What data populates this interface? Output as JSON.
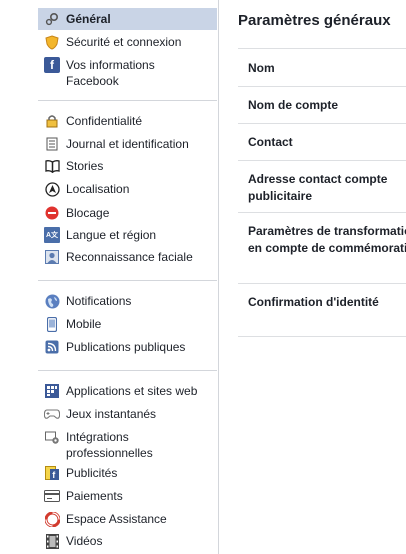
{
  "sidebar": {
    "items": [
      {
        "label": "Général",
        "icon": "gears-icon"
      },
      {
        "label": "Sécurité et connexion",
        "icon": "shield-icon"
      },
      {
        "label": "Vos informations Facebook",
        "icon": "facebook-icon"
      },
      {
        "label": "Confidentialité",
        "icon": "lock-icon"
      },
      {
        "label": "Journal et identification",
        "icon": "journal-icon"
      },
      {
        "label": "Stories",
        "icon": "book-icon"
      },
      {
        "label": "Localisation",
        "icon": "location-icon"
      },
      {
        "label": "Blocage",
        "icon": "block-icon"
      },
      {
        "label": "Langue et région",
        "icon": "language-icon"
      },
      {
        "label": "Reconnaissance faciale",
        "icon": "face-icon"
      },
      {
        "label": "Notifications",
        "icon": "globe-icon"
      },
      {
        "label": "Mobile",
        "icon": "mobile-icon"
      },
      {
        "label": "Publications publiques",
        "icon": "rss-icon"
      },
      {
        "label": "Applications et sites web",
        "icon": "apps-icon"
      },
      {
        "label": "Jeux instantanés",
        "icon": "gamepad-icon"
      },
      {
        "label": "Intégrations professionnelles",
        "icon": "business-gear-icon"
      },
      {
        "label": "Publicités",
        "icon": "ads-icon"
      },
      {
        "label": "Paiements",
        "icon": "card-icon"
      },
      {
        "label": "Espace Assistance",
        "icon": "lifebuoy-icon"
      },
      {
        "label": "Vidéos",
        "icon": "film-icon"
      }
    ]
  },
  "main": {
    "title": "Paramètres généraux",
    "rows": [
      "Nom",
      "Nom de compte",
      "Contact",
      "Adresse contact compte publicitaire",
      "Paramètres de transformation en compte de commémoration",
      "Confirmation d'identité"
    ]
  }
}
